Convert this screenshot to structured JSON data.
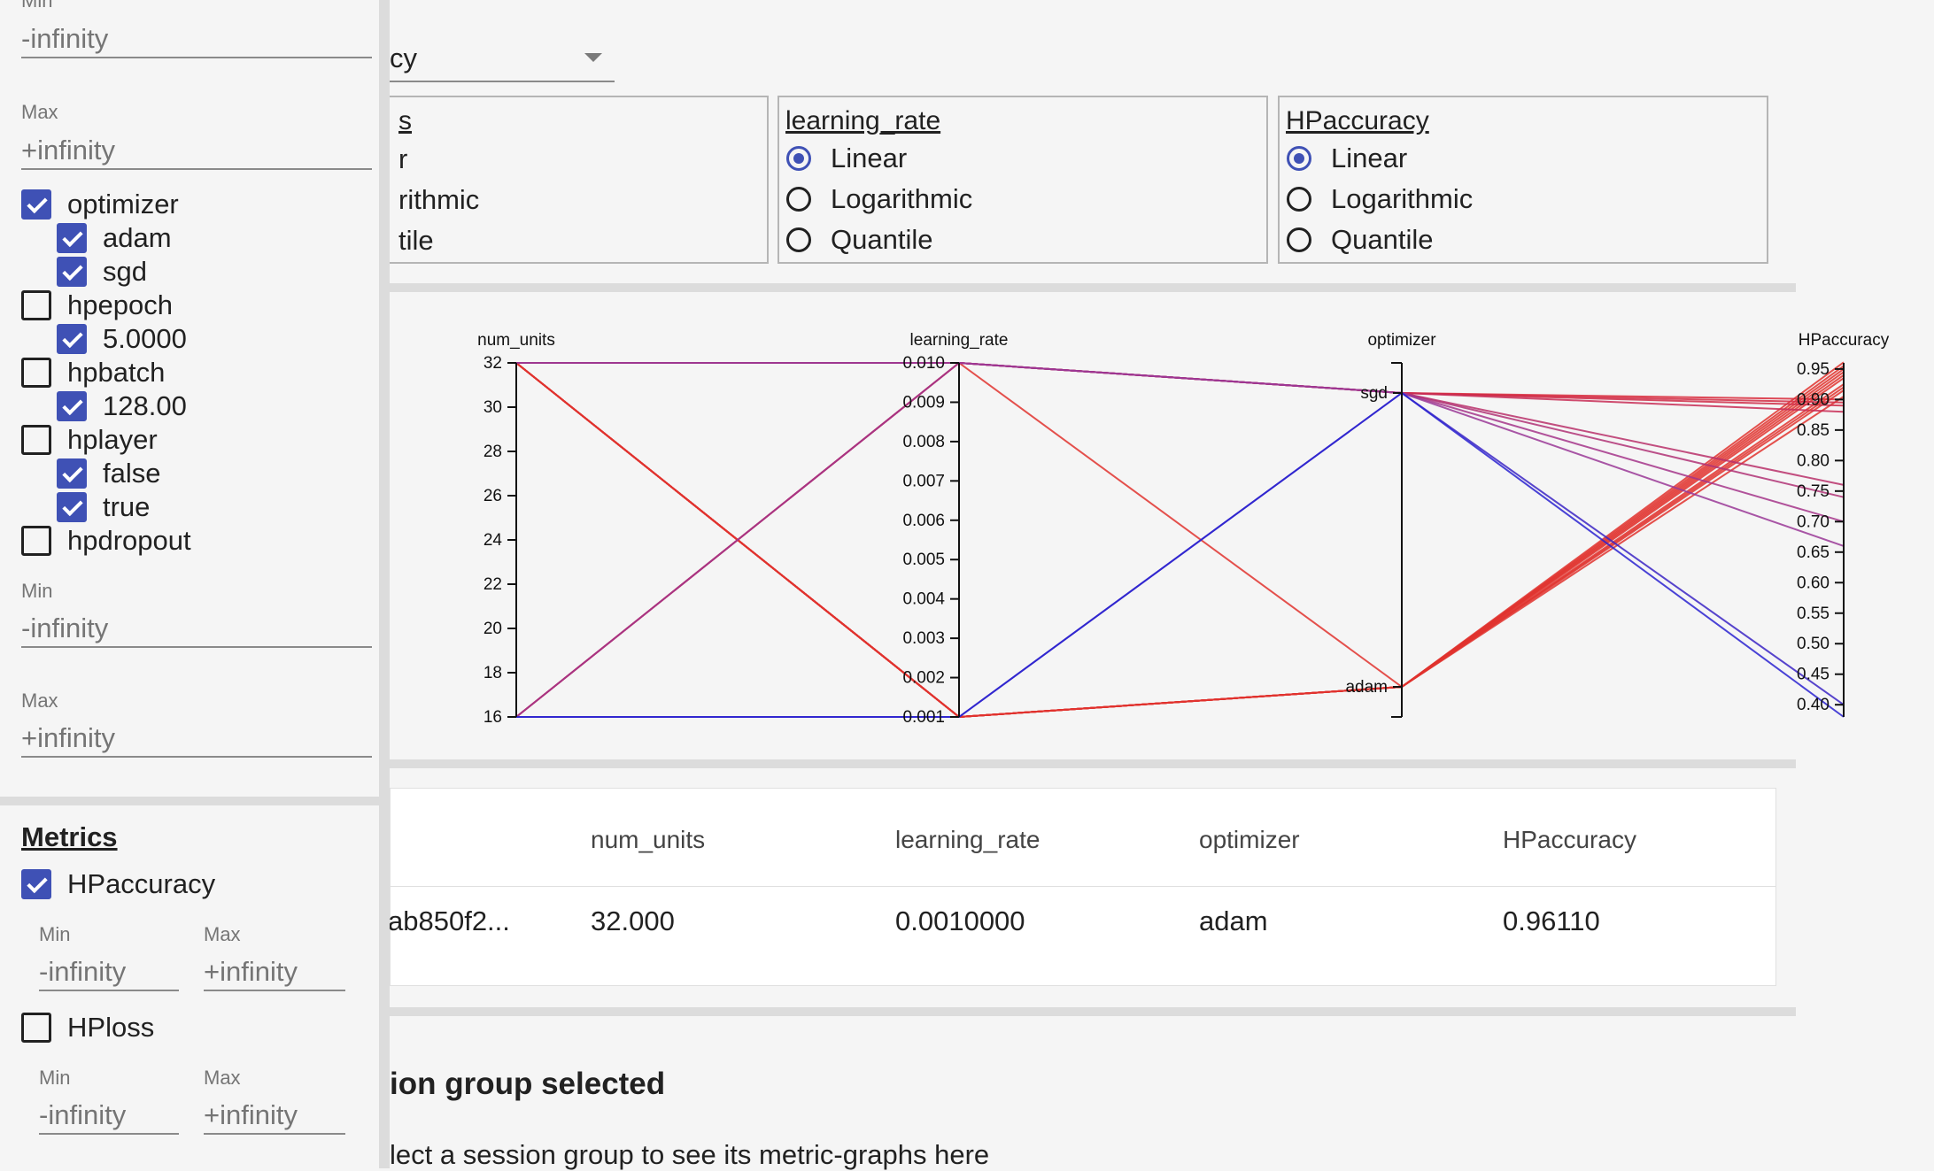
{
  "metric_select": {
    "value_fragment": "cy"
  },
  "scale_boxes": [
    {
      "title": "s",
      "fragments": [
        "r",
        "rithmic",
        "tile"
      ]
    },
    {
      "title": "learning_rate",
      "options": [
        "Linear",
        "Logarithmic",
        "Quantile"
      ],
      "selected": "Linear"
    },
    {
      "title": "HPaccuracy",
      "options": [
        "Linear",
        "Logarithmic",
        "Quantile"
      ],
      "selected": "Linear"
    }
  ],
  "filters": {
    "top_min_label": "Min",
    "top_min_placeholder": "-infinity",
    "top_max_label": "Max",
    "top_max_placeholder": "+infinity",
    "hparams": [
      {
        "name": "optimizer",
        "checked": true,
        "values": [
          {
            "name": "adam",
            "checked": true
          },
          {
            "name": "sgd",
            "checked": true
          }
        ]
      },
      {
        "name": "hpepoch",
        "checked": false,
        "values": [
          {
            "name": "5.0000",
            "checked": true
          }
        ]
      },
      {
        "name": "hpbatch",
        "checked": false,
        "values": [
          {
            "name": "128.00",
            "checked": true
          }
        ]
      },
      {
        "name": "hplayer",
        "checked": false,
        "values": [
          {
            "name": "false",
            "checked": true
          },
          {
            "name": "true",
            "checked": true
          }
        ]
      },
      {
        "name": "hpdropout",
        "checked": false
      }
    ],
    "dropout_min_label": "Min",
    "dropout_min_placeholder": "-infinity",
    "dropout_max_label": "Max",
    "dropout_max_placeholder": "+infinity",
    "metrics_title": "Metrics",
    "metrics": [
      {
        "name": "HPaccuracy",
        "checked": true,
        "min_label": "Min",
        "min_placeholder": "-infinity",
        "max_label": "Max",
        "max_placeholder": "+infinity"
      },
      {
        "name": "HPloss",
        "checked": false,
        "min_label": "Min",
        "min_placeholder": "-infinity",
        "max_label": "Max",
        "max_placeholder": "+infinity"
      }
    ]
  },
  "chart_data": {
    "type": "parallel_coordinates",
    "axes": [
      {
        "name": "num_units",
        "kind": "linear",
        "range": [
          16,
          32
        ],
        "ticks": [
          "16",
          "18",
          "20",
          "22",
          "24",
          "26",
          "28",
          "30",
          "32"
        ]
      },
      {
        "name": "learning_rate",
        "kind": "linear",
        "range": [
          0.001,
          0.01
        ],
        "ticks": [
          "0.001",
          "0.002",
          "0.003",
          "0.004",
          "0.005",
          "0.006",
          "0.007",
          "0.008",
          "0.009",
          "0.010"
        ]
      },
      {
        "name": "optimizer",
        "kind": "categorical",
        "categories": [
          "adam",
          "sgd"
        ]
      },
      {
        "name": "HPaccuracy",
        "kind": "linear",
        "range": [
          0.38,
          0.96
        ],
        "ticks": [
          "0.40",
          "0.45",
          "0.50",
          "0.55",
          "0.60",
          "0.65",
          "0.70",
          "0.75",
          "0.80",
          "0.85",
          "0.90",
          "0.95"
        ]
      }
    ],
    "lines": [
      {
        "values": [
          32,
          0.001,
          "adam",
          0.961
        ],
        "color": "#e0332e"
      },
      {
        "values": [
          32,
          0.001,
          "adam",
          0.955
        ],
        "color": "#e0332e"
      },
      {
        "values": [
          32,
          0.001,
          "adam",
          0.95
        ],
        "color": "#e0332e"
      },
      {
        "values": [
          32,
          0.001,
          "adam",
          0.945
        ],
        "color": "#e0332e"
      },
      {
        "values": [
          32,
          0.001,
          "adam",
          0.94
        ],
        "color": "#e0332e"
      },
      {
        "values": [
          32,
          0.001,
          "adam",
          0.935
        ],
        "color": "#e0332e"
      },
      {
        "values": [
          32,
          0.001,
          "adam",
          0.925
        ],
        "color": "#e0332e"
      },
      {
        "values": [
          32,
          0.001,
          "adam",
          0.915
        ],
        "color": "#e0332e"
      },
      {
        "values": [
          32,
          0.001,
          "adam",
          0.905
        ],
        "color": "#e0332e"
      },
      {
        "values": [
          16,
          0.01,
          "sgd",
          0.9
        ],
        "color": "#d8293a"
      },
      {
        "values": [
          16,
          0.01,
          "sgd",
          0.895
        ],
        "color": "#d22b44"
      },
      {
        "values": [
          32,
          0.01,
          "sgd",
          0.89
        ],
        "color": "#cf2b48"
      },
      {
        "values": [
          32,
          0.01,
          "sgd",
          0.88
        ],
        "color": "#c82d56"
      },
      {
        "values": [
          32,
          0.01,
          "adam",
          0.92
        ],
        "color": "#e0332e"
      },
      {
        "values": [
          16,
          0.01,
          "sgd",
          0.76
        ],
        "color": "#b8306a"
      },
      {
        "values": [
          32,
          0.01,
          "sgd",
          0.74
        ],
        "color": "#b03376"
      },
      {
        "values": [
          16,
          0.01,
          "sgd",
          0.7
        ],
        "color": "#a5358a"
      },
      {
        "values": [
          32,
          0.01,
          "sgd",
          0.66
        ],
        "color": "#9a3896"
      },
      {
        "values": [
          16,
          0.001,
          "sgd",
          0.4
        ],
        "color": "#3b25c4"
      },
      {
        "values": [
          16,
          0.001,
          "sgd",
          0.38
        ],
        "color": "#2a22d0"
      }
    ]
  },
  "table": {
    "headers": [
      "num_units",
      "learning_rate",
      "optimizer",
      "HPaccuracy"
    ],
    "row": {
      "session_fragment": "ab850f2...",
      "num_units": "32.000",
      "learning_rate": "0.0010000",
      "optimizer": "adam",
      "HPaccuracy": "0.96110"
    }
  },
  "no_selection": {
    "title": "ion group selected",
    "subtitle": "lect a session group to see its metric-graphs here"
  }
}
